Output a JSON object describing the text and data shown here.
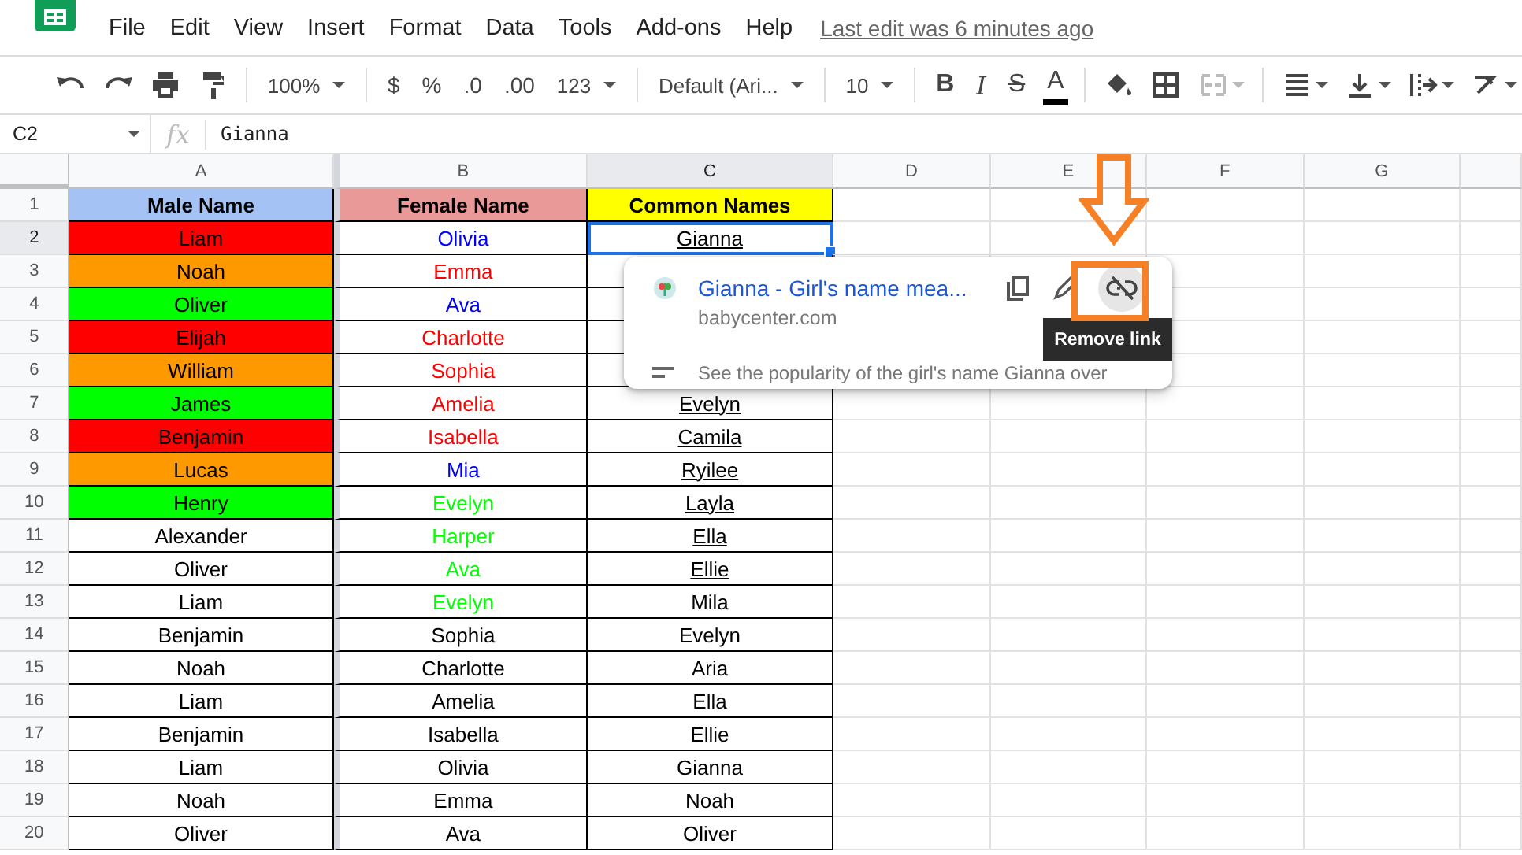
{
  "menu": {
    "items": [
      "File",
      "Edit",
      "View",
      "Insert",
      "Format",
      "Data",
      "Tools",
      "Add-ons",
      "Help"
    ],
    "last_edit": "Last edit was 6 minutes ago"
  },
  "toolbar": [
    {
      "kind": "icon"
    },
    {
      "kind": "icon"
    },
    {
      "kind": "icon"
    },
    {
      "kind": "icon"
    },
    {
      "kind": "sep"
    },
    {
      "kind": "dropdown",
      "label": "100%"
    },
    {
      "kind": "sep"
    },
    {
      "kind": "text",
      "label": "$"
    },
    {
      "kind": "text",
      "label": "%"
    },
    {
      "kind": "text",
      "label": ".0"
    },
    {
      "kind": "text",
      "label": ".00"
    },
    {
      "kind": "dropdown",
      "label": "123"
    },
    {
      "kind": "sep"
    },
    {
      "kind": "dropdown",
      "label": "Default (Ari..."
    },
    {
      "kind": "sep"
    },
    {
      "kind": "dropdown",
      "label": "10"
    },
    {
      "kind": "sep"
    },
    {
      "kind": "format",
      "label": "B"
    },
    {
      "kind": "format",
      "label": "I"
    },
    {
      "kind": "format",
      "label": "S"
    },
    {
      "kind": "format",
      "label": "A"
    },
    {
      "kind": "sep"
    },
    {
      "kind": "icon",
      "disabled": false
    },
    {
      "kind": "icon",
      "disabled": false
    },
    {
      "kind": "icon",
      "disabled": true
    },
    {
      "kind": "sep"
    },
    {
      "kind": "icon"
    },
    {
      "kind": "icon"
    },
    {
      "kind": "icon"
    },
    {
      "kind": "icon"
    }
  ],
  "formula_bar": {
    "cell": "C2",
    "fx": "fx",
    "value": "Gianna"
  },
  "columns": [
    {
      "label": "A",
      "selected": false
    },
    {
      "label": "B",
      "selected": false
    },
    {
      "label": "C",
      "selected": true
    },
    {
      "label": "D",
      "selected": false
    },
    {
      "label": "E",
      "selected": false
    },
    {
      "label": "F",
      "selected": false
    },
    {
      "label": "G",
      "selected": false
    }
  ],
  "rows": [
    {
      "num": "1",
      "selected": false,
      "a": {
        "text": "Male Name",
        "color": "#a4c2f4"
      },
      "b": {
        "text": "Female Name",
        "color": "#ea9999"
      },
      "c": {
        "text": "Common Names",
        "color": "#ffff00"
      }
    },
    {
      "num": "2",
      "selected": true,
      "a": {
        "text": "Liam",
        "color": "#ff0000"
      },
      "b": {
        "text": "Olivia",
        "color": "#0000ff"
      },
      "c": {
        "text": "Gianna",
        "link": true,
        "selected": true
      }
    },
    {
      "num": "3",
      "selected": false,
      "a": {
        "text": "Noah",
        "color": "#ff9900"
      },
      "b": {
        "text": "Emma",
        "color": "#ff0000"
      },
      "c": {}
    },
    {
      "num": "4",
      "selected": false,
      "a": {
        "text": "Oliver",
        "color": "#00ff00"
      },
      "b": {
        "text": "Ava",
        "color": "#0000ff"
      },
      "c": {}
    },
    {
      "num": "5",
      "selected": false,
      "a": {
        "text": "Elijah",
        "color": "#ff0000"
      },
      "b": {
        "text": "Charlotte",
        "color": "#ff0000"
      },
      "c": {}
    },
    {
      "num": "6",
      "selected": false,
      "a": {
        "text": "William",
        "color": "#ff9900"
      },
      "b": {
        "text": "Sophia",
        "color": "#ff0000"
      },
      "c": {}
    },
    {
      "num": "7",
      "selected": false,
      "a": {
        "text": "James",
        "color": "#00ff00"
      },
      "b": {
        "text": "Amelia",
        "color": "#ff0000"
      },
      "c": {
        "text": "Evelyn",
        "link": true
      }
    },
    {
      "num": "8",
      "selected": false,
      "a": {
        "text": "Benjamin",
        "color": "#ff0000"
      },
      "b": {
        "text": "Isabella",
        "color": "#ff0000"
      },
      "c": {
        "text": "Camila",
        "link": true
      }
    },
    {
      "num": "9",
      "selected": false,
      "a": {
        "text": "Lucas",
        "color": "#ff9900"
      },
      "b": {
        "text": "Mia",
        "color": "#0000ff"
      },
      "c": {
        "text": "Ryilee",
        "link": true
      }
    },
    {
      "num": "10",
      "selected": false,
      "a": {
        "text": "Henry",
        "color": "#00ff00"
      },
      "b": {
        "text": "Evelyn",
        "color": "#00ff00"
      },
      "c": {
        "text": "Layla",
        "link": true
      }
    },
    {
      "num": "11",
      "selected": false,
      "a": {
        "text": "Alexander"
      },
      "b": {
        "text": "Harper",
        "color": "#00ff00"
      },
      "c": {
        "text": "Ella",
        "link": true
      }
    },
    {
      "num": "12",
      "selected": false,
      "a": {
        "text": "Oliver"
      },
      "b": {
        "text": "Ava",
        "color": "#00ff00"
      },
      "c": {
        "text": "Ellie",
        "link": true
      }
    },
    {
      "num": "13",
      "selected": false,
      "a": {
        "text": "Liam"
      },
      "b": {
        "text": "Evelyn",
        "color": "#00ff00"
      },
      "c": {
        "text": "Mila"
      }
    },
    {
      "num": "14",
      "selected": false,
      "a": {
        "text": "Benjamin"
      },
      "b": {
        "text": "Sophia"
      },
      "c": {
        "text": "Evelyn"
      }
    },
    {
      "num": "15",
      "selected": false,
      "a": {
        "text": "Noah"
      },
      "b": {
        "text": "Charlotte"
      },
      "c": {
        "text": "Aria"
      }
    },
    {
      "num": "16",
      "selected": false,
      "a": {
        "text": "Liam"
      },
      "b": {
        "text": "Amelia"
      },
      "c": {
        "text": "Ella"
      }
    },
    {
      "num": "17",
      "selected": false,
      "a": {
        "text": "Benjamin"
      },
      "b": {
        "text": "Isabella"
      },
      "c": {
        "text": "Ellie"
      }
    },
    {
      "num": "18",
      "selected": false,
      "a": {
        "text": "Liam"
      },
      "b": {
        "text": "Olivia"
      },
      "c": {
        "text": "Gianna"
      }
    },
    {
      "num": "19",
      "selected": false,
      "a": {
        "text": "Noah"
      },
      "b": {
        "text": "Emma"
      },
      "c": {
        "text": "Noah"
      }
    },
    {
      "num": "20",
      "selected": false,
      "a": {
        "text": "Oliver"
      },
      "b": {
        "text": "Ava"
      },
      "c": {
        "text": "Oliver"
      }
    }
  ],
  "link_popup": {
    "title": "Gianna - Girl's name mea...",
    "domain": "babycenter.com",
    "description": "See the popularity of the girl's name Gianna over",
    "tooltip": "Remove link"
  }
}
